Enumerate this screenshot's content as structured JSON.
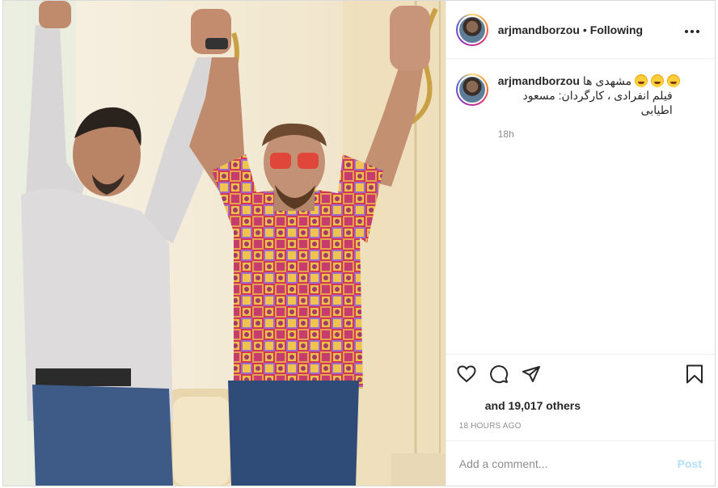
{
  "post": {
    "username": "arjmandborzou",
    "separator": "•",
    "follow_state": "Following",
    "more_icon": "more-horizontal-icon",
    "caption_line1": "مشهدی ها",
    "caption_emoji_count": 3,
    "caption_line2": "فیلم انفرادی ، کارگردان: مسعود اطیابی",
    "caption_time": "18h",
    "likes_text": "and 19,017 others",
    "timestamp": "18 HOURS AGO",
    "comment_placeholder": "Add a comment...",
    "post_button": "Post"
  },
  "icons": {
    "like": "heart-icon",
    "comment": "comment-icon",
    "share": "share-icon",
    "save": "bookmark-icon"
  },
  "colors": {
    "post_button_disabled": "#b2dffc",
    "muted_text": "#8e8e8e",
    "border": "#dbdbdb"
  }
}
